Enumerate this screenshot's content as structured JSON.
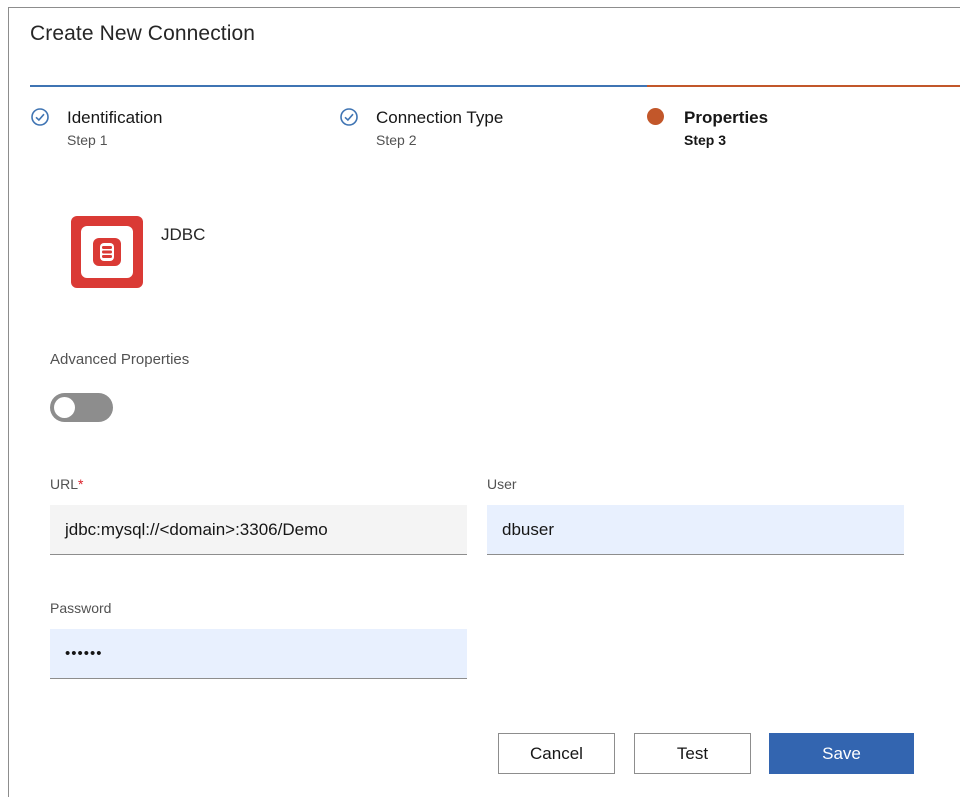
{
  "dialog": {
    "title": "Create New Connection"
  },
  "steps": [
    {
      "name": "Identification",
      "sub": "Step 1",
      "state": "complete"
    },
    {
      "name": "Connection Type",
      "sub": "Step 2",
      "state": "complete"
    },
    {
      "name": "Properties",
      "sub": "Step 3",
      "state": "current"
    }
  ],
  "connection": {
    "name": "JDBC",
    "icon": "database-icon"
  },
  "advanced": {
    "label": "Advanced Properties",
    "enabled": false
  },
  "fields": {
    "url": {
      "label": "URL",
      "required_mark": "*",
      "value": "jdbc:mysql://<domain>:3306/Demo"
    },
    "user": {
      "label": "User",
      "value": "dbuser"
    },
    "password": {
      "label": "Password",
      "value": "••••••"
    }
  },
  "buttons": {
    "cancel": "Cancel",
    "test": "Test",
    "save": "Save"
  },
  "colors": {
    "accent_blue": "#3f74b3",
    "current_orange": "#c2572a",
    "jdbc_red": "#da3a35",
    "save_button": "#3365b0",
    "required_red": "#da1e28"
  }
}
